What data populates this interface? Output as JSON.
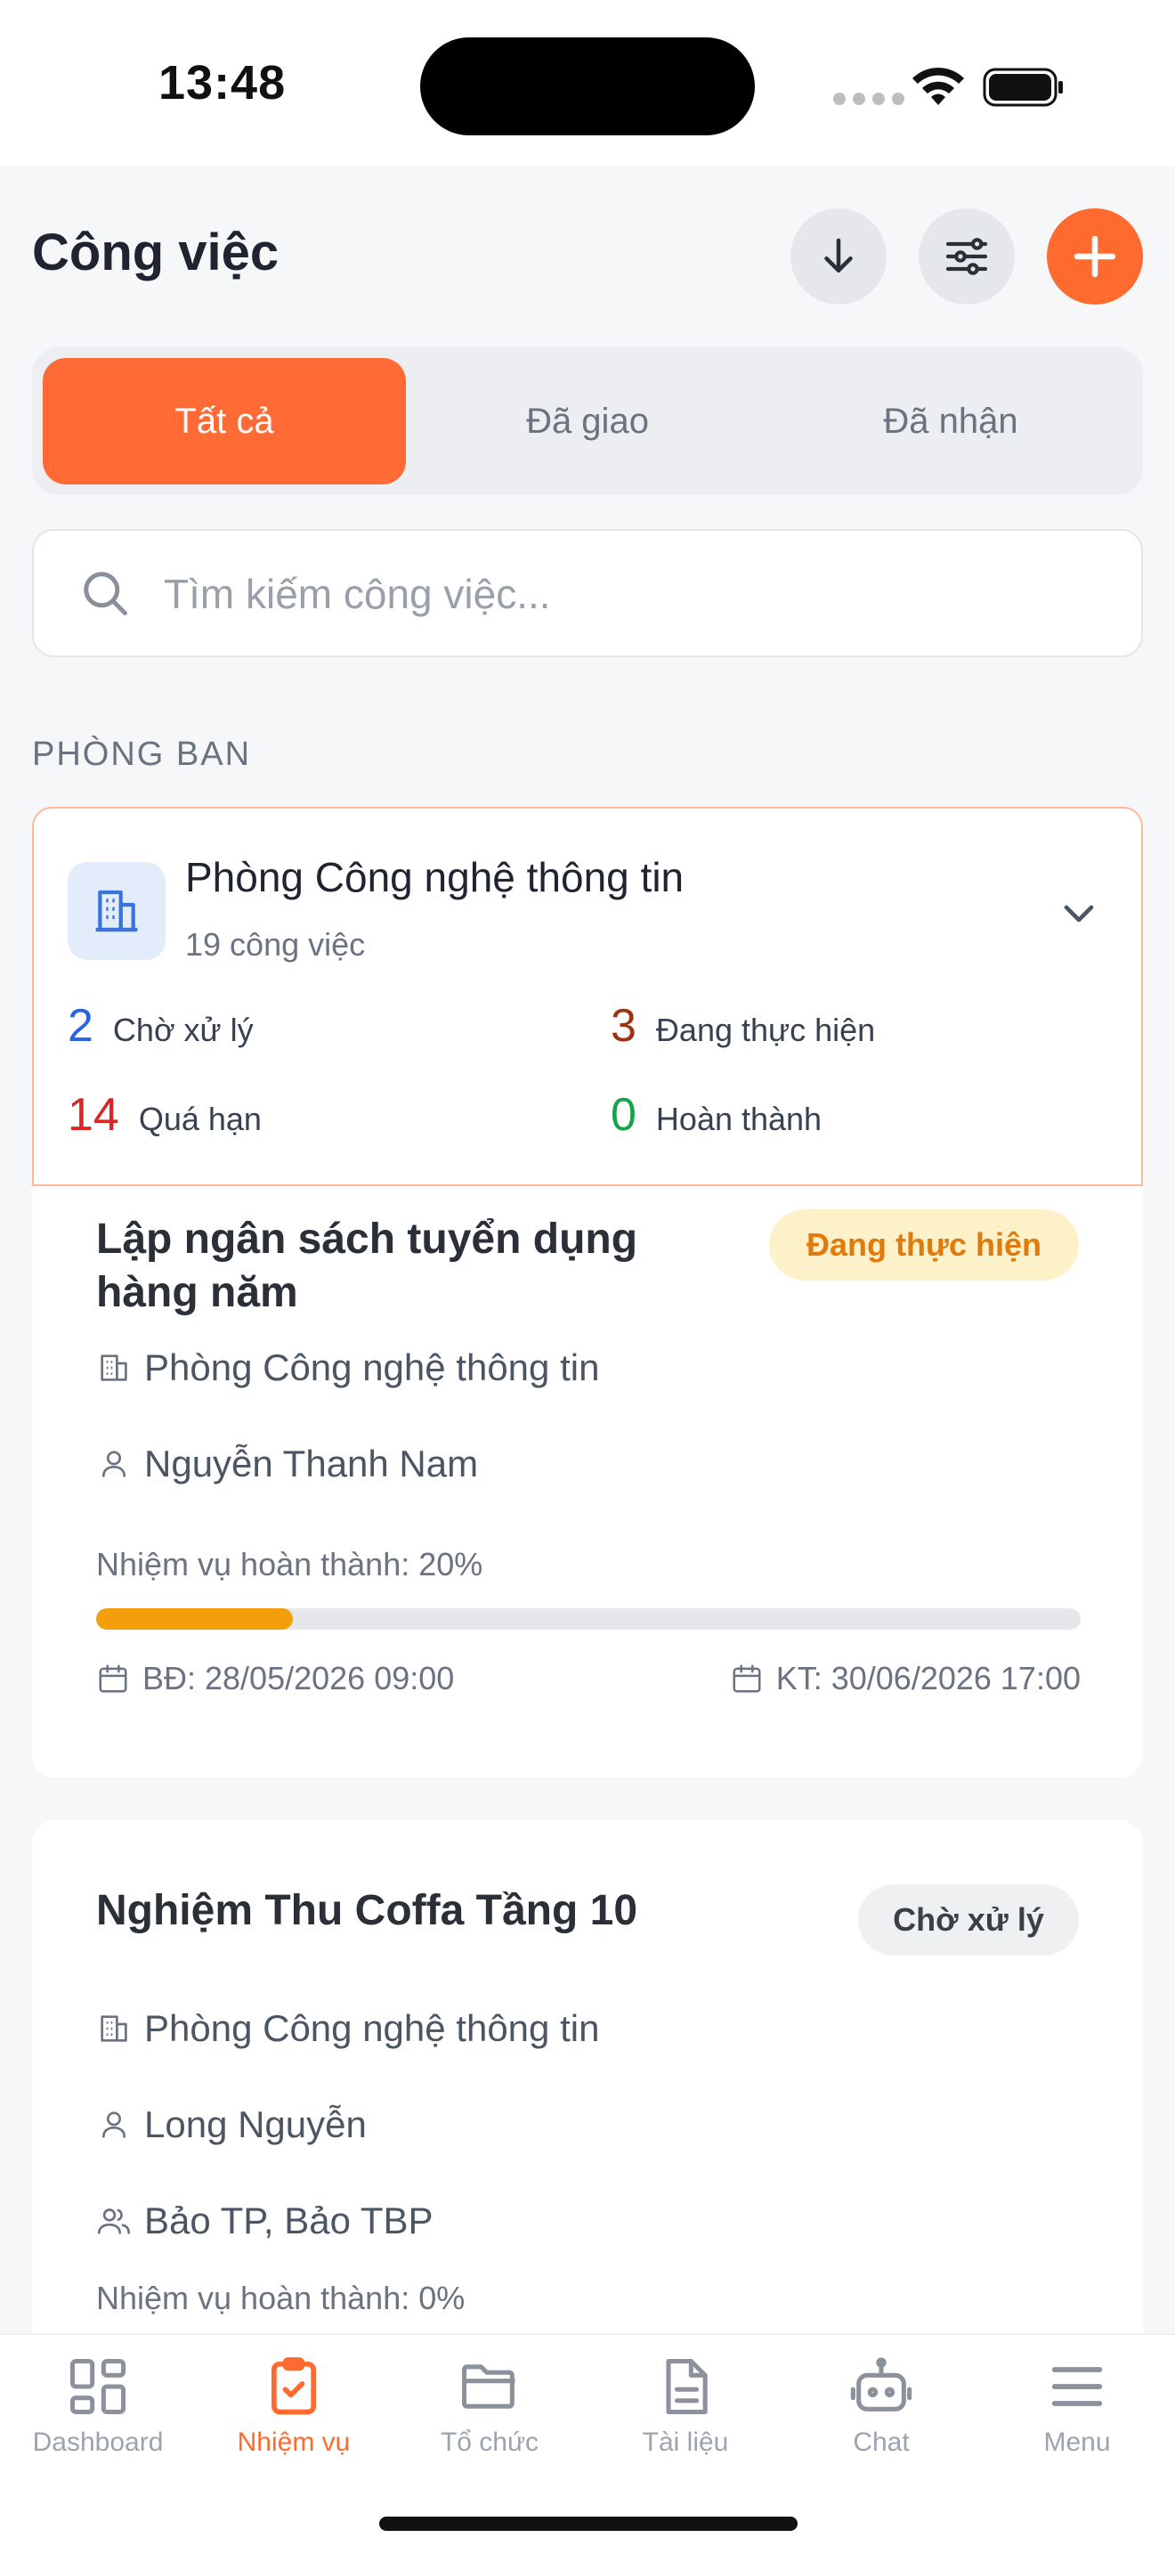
{
  "status_bar": {
    "time": "13:48"
  },
  "header": {
    "title": "Công việc",
    "buttons": {
      "download_icon": "arrow-down-icon",
      "filter_icon": "sliders-icon",
      "add_icon": "plus-icon"
    }
  },
  "tabs": [
    {
      "label": "Tất cả",
      "active": true
    },
    {
      "label": "Đã giao",
      "active": false
    },
    {
      "label": "Đã nhận",
      "active": false
    }
  ],
  "search": {
    "placeholder": "Tìm kiếm công việc...",
    "value": ""
  },
  "section_label": "PHÒNG BAN",
  "department": {
    "name": "Phòng Công nghệ thông tin",
    "count_text": "19 công việc",
    "stats": [
      {
        "value": "2",
        "label": "Chờ xử lý",
        "color": "#2563eb"
      },
      {
        "value": "3",
        "label": "Đang thực hiện",
        "color": "#9a3412"
      },
      {
        "value": "14",
        "label": "Quá hạn",
        "color": "#dc2626"
      },
      {
        "value": "0",
        "label": "Hoàn thành",
        "color": "#16a34a"
      }
    ]
  },
  "tasks": [
    {
      "title_line1": "Lập ngân sách tuyển dụng",
      "title_line2": "hàng năm",
      "status": "Đang thực hiện",
      "department": "Phòng Công nghệ thông tin",
      "assignee": "Nguyễn Thanh Nam",
      "progress_label": "Nhiệm vụ hoàn thành: 20%",
      "progress": 0.2,
      "start": "BĐ: 28/05/2026 09:00",
      "end": "KT: 30/06/2026 17:00"
    },
    {
      "title": "Nghiệm Thu Coffa Tầng 10",
      "status": "Chờ xử lý",
      "department": "Phòng Công nghệ thông tin",
      "assignee": "Long Nguyễn",
      "members": "Bảo TP, Bảo TBP",
      "progress_label": "Nhiệm vụ hoàn thành: 0%",
      "progress": 0
    }
  ],
  "bottom_nav": [
    {
      "label": "Dashboard",
      "icon": "dashboard-icon",
      "active": false
    },
    {
      "label": "Nhiệm vụ",
      "icon": "clipboard-check-icon",
      "active": true
    },
    {
      "label": "Tổ chức",
      "icon": "folder-icon",
      "active": false
    },
    {
      "label": "Tài liệu",
      "icon": "document-icon",
      "active": false
    },
    {
      "label": "Chat",
      "icon": "bot-icon",
      "active": false
    },
    {
      "label": "Menu",
      "icon": "menu-icon",
      "active": false
    }
  ],
  "colors": {
    "accent": "#ff6a2e",
    "progress_fill": "#f59e0b"
  }
}
